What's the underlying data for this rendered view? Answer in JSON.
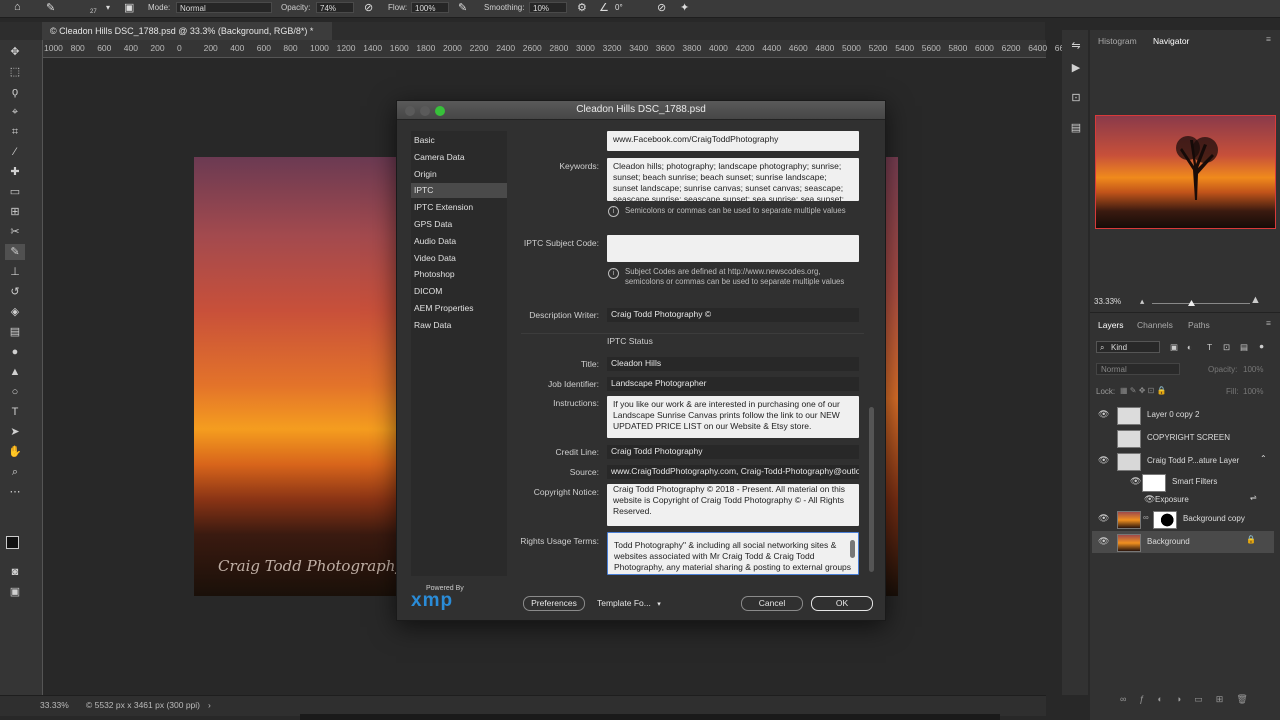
{
  "options_bar": {
    "brush_size": "27",
    "mode_label": "Mode:",
    "mode_value": "Normal",
    "opacity_label": "Opacity:",
    "opacity_value": "74%",
    "flow_label": "Flow:",
    "flow_value": "100%",
    "smoothing_label": "Smoothing:",
    "smoothing_value": "10%",
    "angle_value": "0°"
  },
  "document": {
    "tab_title": "© Cleadon Hills DSC_1788.psd @ 33.3% (Background, RGB/8*) *",
    "ruler_ticks": [
      "1000",
      "800",
      "600",
      "400",
      "200",
      "0",
      "200",
      "400",
      "600",
      "800",
      "1000",
      "1200",
      "1400",
      "1600",
      "1800",
      "2000",
      "2200",
      "2400",
      "2600",
      "2800",
      "3000",
      "3200",
      "3400",
      "3600",
      "3800",
      "4000",
      "4200",
      "4400",
      "4600",
      "4800",
      "5000",
      "5200",
      "5400",
      "5600",
      "5800",
      "6000",
      "6200",
      "6400",
      "66"
    ],
    "watermark": "Craig Todd Photography"
  },
  "status_bar": {
    "zoom": "33.33%",
    "doc_info": "© 5532 px x 3461 px (300 ppi)"
  },
  "dialog": {
    "title": "Cleadon Hills DSC_1788.psd",
    "categories": [
      "Basic",
      "Camera Data",
      "Origin",
      "IPTC",
      "IPTC Extension",
      "GPS Data",
      "Audio Data",
      "Video Data",
      "Photoshop",
      "DICOM",
      "AEM Properties",
      "Raw Data"
    ],
    "selected_category": "IPTC",
    "fields": {
      "website_value": "www.Facebook.com/CraigToddPhotography",
      "keywords_label": "Keywords:",
      "keywords_value": "Cleadon hills; photography; landscape photography; sunrise; sunset; beach sunrise; beach sunset; sunrise landscape; sunset landscape; sunrise canvas; sunset canvas; seascape; seascape sunrise; seascape sunset; sea sunrise; sea sunset; ocean sunrise",
      "keywords_hint": "Semicolons or commas can be used to separate multiple values",
      "subject_code_label": "IPTC Subject Code:",
      "subject_code_value": "",
      "subject_code_hint": "Subject Codes are defined at http://www.newscodes.org, semicolons or commas can be used to separate multiple values",
      "description_writer_label": "Description Writer:",
      "description_writer_value": "Craig Todd Photography ©",
      "iptc_status_heading": "IPTC Status",
      "title_label": "Title:",
      "title_value": "Cleadon Hills",
      "job_identifier_label": "Job Identifier:",
      "job_identifier_value": "Landscape Photographer",
      "instructions_label": "Instructions:",
      "instructions_value": "If you like our work & are interested in purchasing one of our Landscape Sunrise Canvas prints follow the link to our NEW UPDATED PRICE LIST on our Website & Etsy store.",
      "credit_line_label": "Credit Line:",
      "credit_line_value": "Craig Todd Photography",
      "source_label": "Source:",
      "source_value": "www.CraigToddPhotography.com, Craig-Todd-Photography@outloc",
      "copyright_notice_label": "Copyright Notice:",
      "copyright_notice_value": "Craig Todd Photography © 2018 - Present. All material on this website is Copyright of Craig Todd Photography © - All Rights Reserved.",
      "rights_usage_label": "Rights Usage Terms:",
      "rights_usage_value": "Todd Photography\" & including all social networking sites & websites associated with Mr Craig Todd & Craig Todd Photography, any material sharing & posting to external groups"
    },
    "powered_by": "Powered By",
    "xmp_logo": "xmp",
    "preferences_button": "Preferences",
    "template_dropdown": "Template Fo...",
    "cancel_button": "Cancel",
    "ok_button": "OK"
  },
  "right_panel": {
    "tabs_top": [
      "Histogram",
      "Navigator"
    ],
    "active_top_tab": "Navigator",
    "nav_zoom": "33.33%",
    "layer_tabs": [
      "Layers",
      "Channels",
      "Paths"
    ],
    "kind_filter": "Kind",
    "blend_mode": "Normal",
    "opacity_label": "Opacity:",
    "opacity_value": "100%",
    "lock_label": "Lock:",
    "fill_label": "Fill:",
    "fill_value": "100%",
    "layers": [
      "Layer 0 copy 2",
      "COPYRIGHT SCREEN",
      "Craig Todd P...ature Layer",
      "Smart Filters",
      "Exposure",
      "Background copy",
      "Background"
    ]
  }
}
